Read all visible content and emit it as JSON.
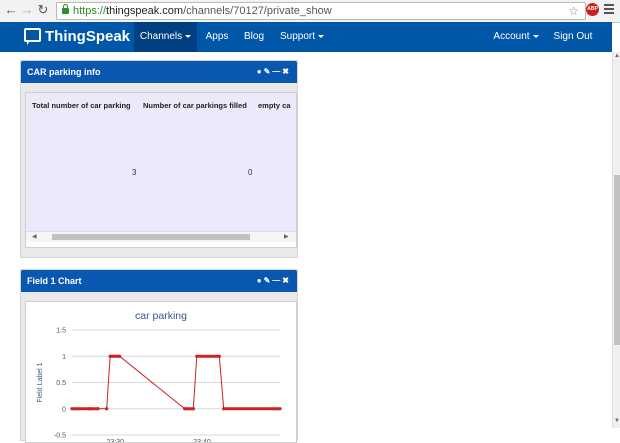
{
  "browser": {
    "url_scheme": "https://",
    "url_host": "thingspeak.com",
    "url_path": "/channels/70127/private_show",
    "back_icon": "back-arrow-icon",
    "forward_icon": "forward-arrow-icon",
    "reload_icon": "reload-icon",
    "abp_label": "ABP"
  },
  "navbar": {
    "brand": "ThingSpeak",
    "items": [
      {
        "label": "Channels",
        "dropdown": true,
        "active": true
      },
      {
        "label": "Apps",
        "dropdown": false
      },
      {
        "label": "Blog",
        "dropdown": false
      },
      {
        "label": "Support",
        "dropdown": true
      },
      {
        "label": "Account",
        "dropdown": true
      },
      {
        "label": "Sign Out",
        "dropdown": false
      }
    ],
    "color": "#0057a8"
  },
  "parking_panel": {
    "title": "CAR parking info",
    "columns": [
      "Total number of car parking",
      "Number of car parkings filled",
      "empty ca"
    ],
    "values": [
      "3",
      "0",
      ""
    ]
  },
  "chart_panel": {
    "title": "Field 1 Chart"
  },
  "chart_data": {
    "type": "line",
    "title": "car parking",
    "ylabel": "Field Label 1",
    "xlabel": "",
    "ylim": [
      -0.5,
      1.5
    ],
    "yticks": [
      "1.5",
      "1",
      "0.5",
      "0",
      "-0.5"
    ],
    "xticks": [
      "23:30",
      "23:40"
    ],
    "series": [
      {
        "color": "#cc2222",
        "points": [
          {
            "x": "23:25",
            "y": 0
          },
          {
            "x": "23:27",
            "y": 0
          },
          {
            "x": "23:28",
            "y": 0
          },
          {
            "x": "23:29",
            "y": 0
          },
          {
            "x": "23:29.4",
            "y": 1
          },
          {
            "x": "23:30.5",
            "y": 1
          },
          {
            "x": "23:38",
            "y": 0
          },
          {
            "x": "23:39",
            "y": 0
          },
          {
            "x": "23:39.4",
            "y": 1
          },
          {
            "x": "23:42",
            "y": 1
          },
          {
            "x": "23:42.5",
            "y": 0
          },
          {
            "x": "23:49",
            "y": 0
          }
        ]
      }
    ]
  }
}
